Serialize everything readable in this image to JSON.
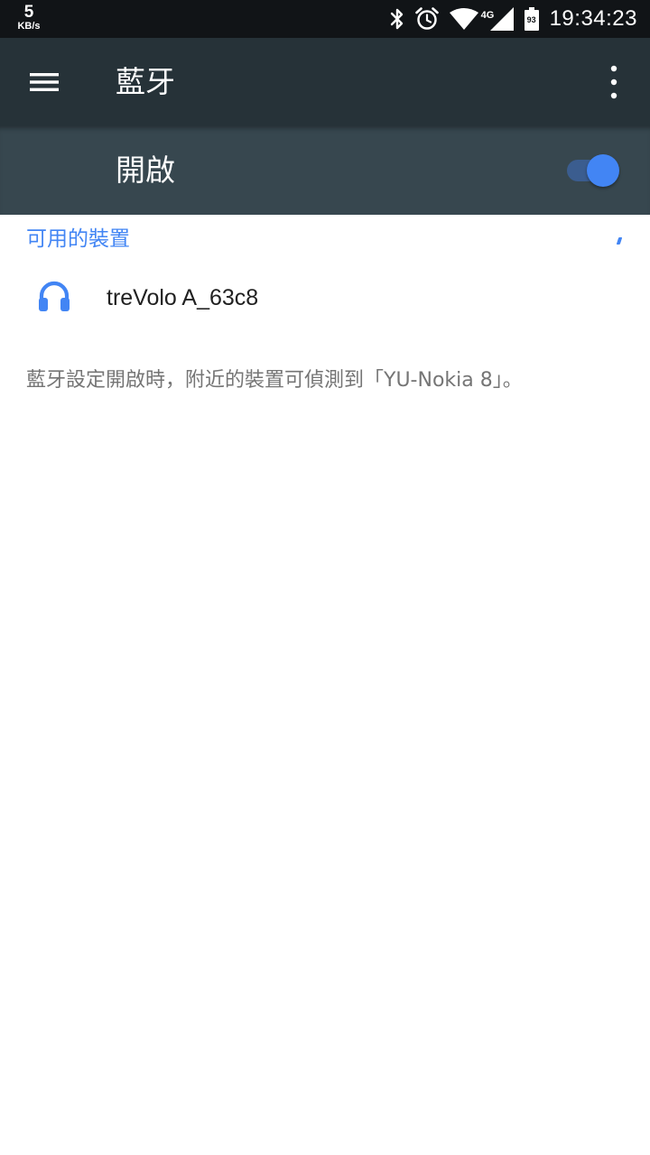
{
  "status_bar": {
    "net_speed_value": "5",
    "net_speed_unit": "KB/s",
    "network_type": "4G",
    "battery_level": "93",
    "time": "19:34:23",
    "icons": [
      "bluetooth-icon",
      "alarm-icon",
      "wifi-icon",
      "cell-signal-icon",
      "battery-icon"
    ]
  },
  "app_bar": {
    "title": "藍牙",
    "menu_icon": "hamburger-menu-icon",
    "overflow_icon": "more-vert-icon"
  },
  "bluetooth_toggle": {
    "label": "開啟",
    "checked": true
  },
  "available_devices": {
    "header": "可用的裝置",
    "devices": [
      {
        "name": "treVolo A_63c8",
        "icon": "headphones-icon"
      }
    ]
  },
  "footer": {
    "visibility_text": "藍牙設定開啟時，附近的裝置可偵測到「YU-Nokia 8」。"
  },
  "colors": {
    "status_bar_bg": "#111417",
    "app_bar_bg": "#263238",
    "toggle_row_bg": "#37474f",
    "accent": "#4285f4",
    "switch_track": "#3b5d8f"
  }
}
